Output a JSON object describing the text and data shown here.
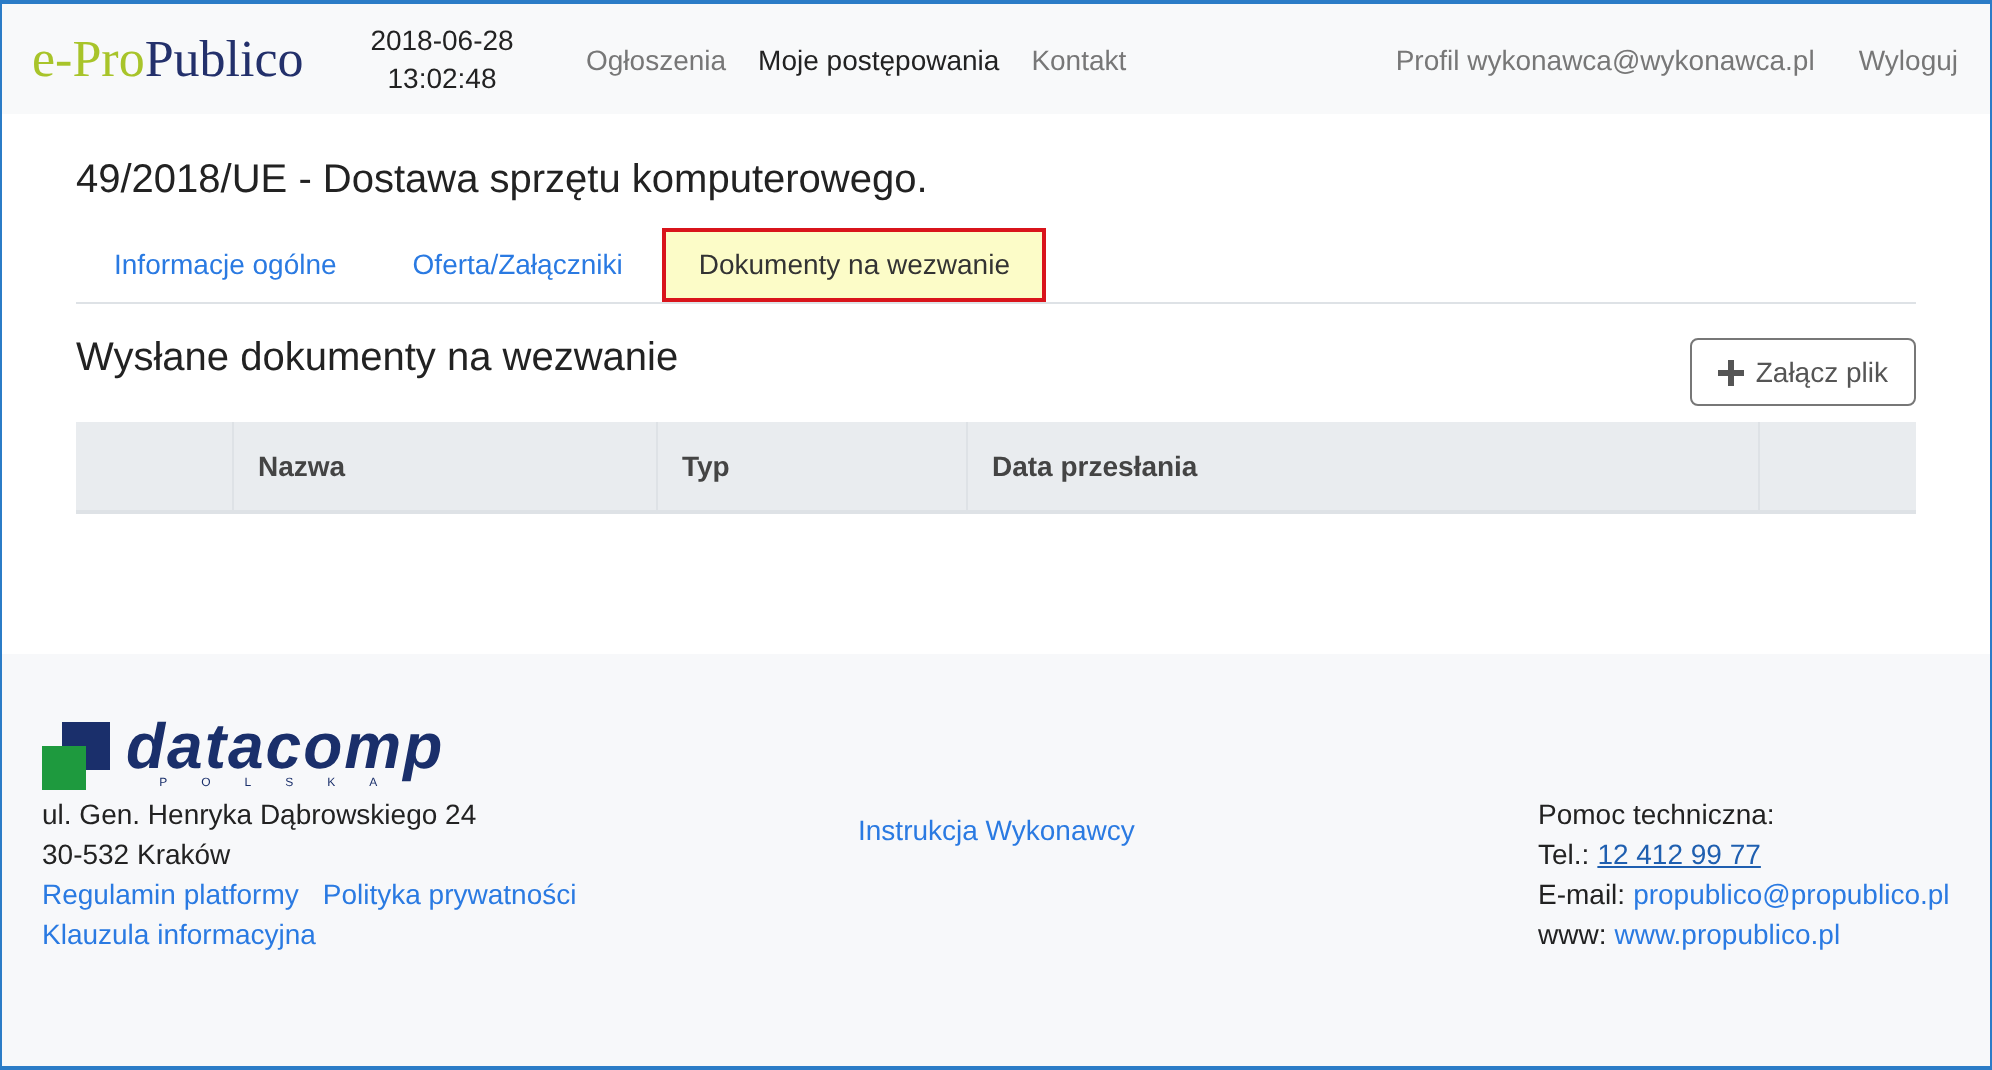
{
  "header": {
    "logo": {
      "part_1": "e-Pro",
      "part_2": "Publico"
    },
    "date": "2018-06-28",
    "time": "13:02:48",
    "nav": [
      {
        "label": "Ogłoszenia",
        "selected": false
      },
      {
        "label": "Moje postępowania",
        "selected": true
      },
      {
        "label": "Kontakt",
        "selected": false
      }
    ],
    "user_links": [
      "Profil wykonawca@wykonawca.pl",
      "Wyloguj"
    ]
  },
  "title": "49/2018/UE - Dostawa sprzętu komputerowego.",
  "tabs": [
    {
      "label": "Informacje ogólne",
      "selected": false
    },
    {
      "label": "Oferta/Załączniki",
      "selected": false
    },
    {
      "label": "Dokumenty na wezwanie",
      "selected": true
    }
  ],
  "section_title": "Wysłane dokumenty na wezwanie",
  "attach_button": "Załącz plik",
  "table": {
    "columns": [
      "",
      "Nazwa",
      "Typ",
      "Data przesłania",
      ""
    ]
  },
  "footer": {
    "company_logo": {
      "name": "datacomp",
      "subtitle": "POLSKA"
    },
    "address": [
      "ul. Gen. Henryka Dąbrowskiego 24",
      "30-532 Kraków"
    ],
    "links": [
      "Regulamin platformy",
      "Polityka prywatności",
      "Klauzula informacyjna"
    ],
    "manual_link": "Instrukcja Wykonawcy",
    "support": {
      "heading": "Pomoc techniczna:",
      "phone_label": "Tel.:",
      "phone": "12 412 99 77",
      "email_label": "E-mail:",
      "email": "propublico@propublico.pl",
      "www_label": "www:",
      "www": "www.propublico.pl"
    }
  }
}
